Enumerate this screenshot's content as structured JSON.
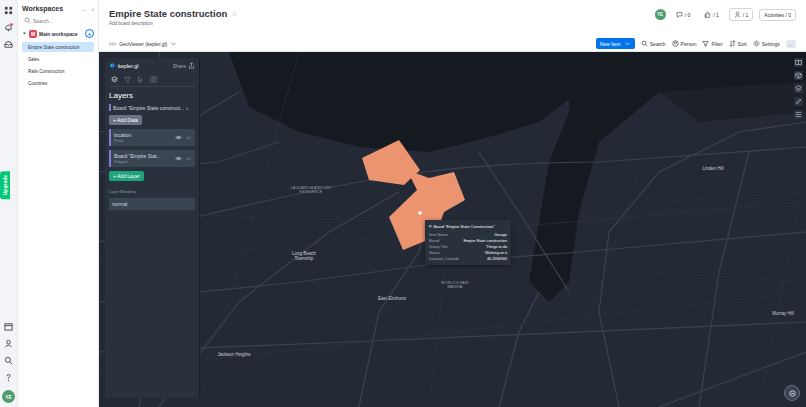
{
  "rail": {
    "upgrade": "Upgrade",
    "avatar": "YE"
  },
  "sidebar": {
    "title": "Workspaces",
    "more": "...",
    "collapse": "‹",
    "search_placeholder": "Search...",
    "workspace": {
      "icon": "M",
      "name": "Main workspace",
      "add": "+",
      "expanded": true
    },
    "items": [
      {
        "label": "Empire State construction",
        "selected": true
      },
      {
        "label": "Sales",
        "selected": false
      },
      {
        "label": "Rails Construction",
        "selected": false
      },
      {
        "label": "Countries",
        "selected": false
      }
    ]
  },
  "board": {
    "title": "Empire State construction",
    "star": "☆",
    "description": "Add board description",
    "avatar": "YE",
    "stats": [
      {
        "kind": "updates",
        "value": "/ 0"
      },
      {
        "kind": "likes",
        "value": "/ 1"
      },
      {
        "kind": "members",
        "value": "/ 1"
      }
    ],
    "activities": "Activities / 0",
    "view": "GeoViewer (kepler.gl)",
    "view_icon": "</>",
    "new_item": "New Item",
    "toolbar": [
      {
        "kind": "search",
        "label": "Search"
      },
      {
        "kind": "person",
        "label": "Person"
      },
      {
        "kind": "filter",
        "label": "Filter"
      },
      {
        "kind": "sort",
        "label": "Sort"
      },
      {
        "kind": "settings",
        "label": "Settings"
      }
    ],
    "more": "..."
  },
  "kepler": {
    "logo": "kepler.gl",
    "share": "Share",
    "tabs": [
      {
        "kind": "layers",
        "selected": true
      },
      {
        "kind": "filters",
        "selected": false
      },
      {
        "kind": "interactions",
        "selected": false
      },
      {
        "kind": "basemap",
        "selected": false
      }
    ],
    "heading": "Layers",
    "dataset": "Board \"Empire State construct...",
    "dataset_arrow": "›",
    "add_data": "+ Add Data",
    "layers": [
      {
        "name": "location",
        "type": "Point",
        "visible": true,
        "color": "#8a78d8"
      },
      {
        "name": "Board \"Empire Stat...",
        "type": "Polygon",
        "visible": true,
        "color": "#8a78d8"
      }
    ],
    "add_layer": "+ Add Layer",
    "blending_label": "Layer Blending",
    "blending": "normal"
  },
  "map": {
    "labels": [
      "LAGUARDIA AIRPORT RESIDENCE",
      "Long Beach Township",
      "WORLD'S FAIR MARINA",
      "East Elmhurst",
      "Jackson Heights",
      "Linden Hill",
      "Murray Hill"
    ],
    "tooltip": {
      "title": "P. Board \"Empire State Construction\"",
      "rows": [
        {
          "key": "Item Name",
          "value": "Garage"
        },
        {
          "key": "Board",
          "value": "Empire State construction"
        },
        {
          "key": "Group Title",
          "value": "Things to do"
        },
        {
          "key": "Status",
          "value": "Working on it"
        },
        {
          "key": "Location_Latitude",
          "value": "40.2584944"
        }
      ]
    }
  }
}
